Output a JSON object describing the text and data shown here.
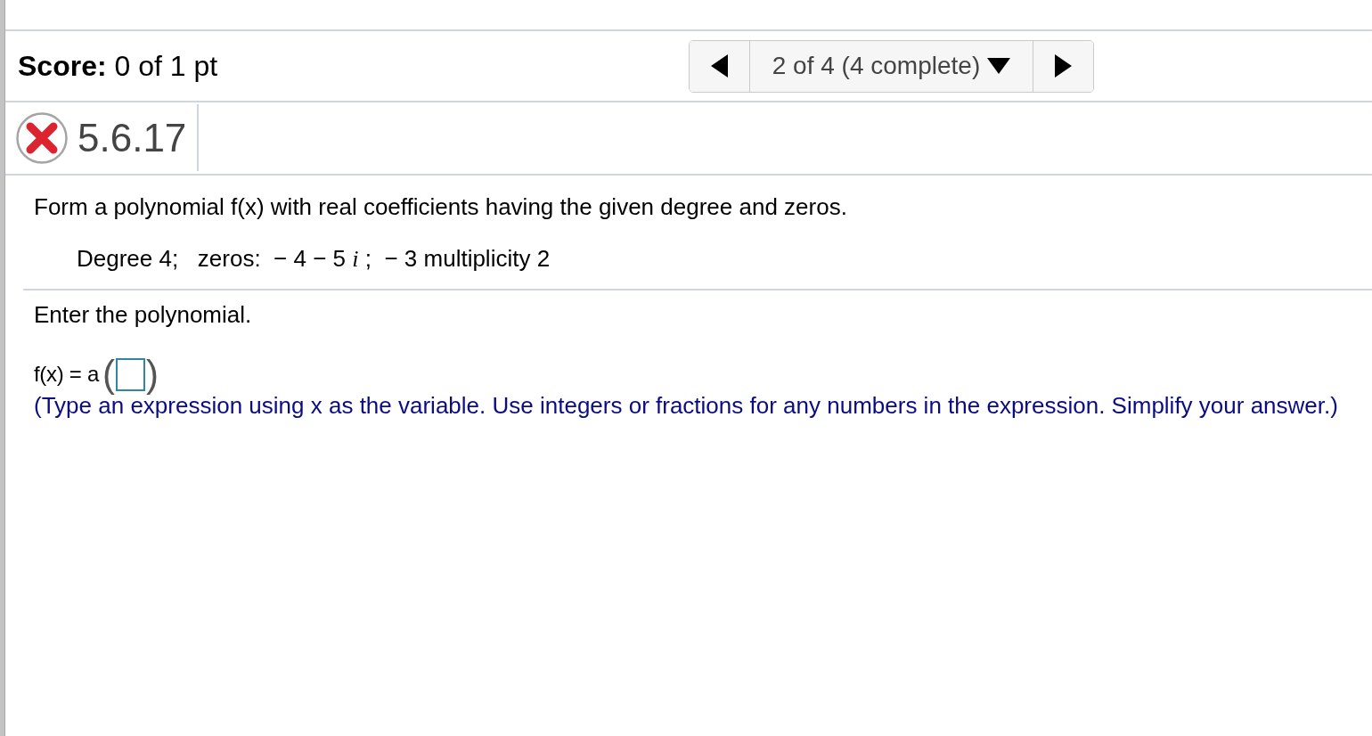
{
  "score": {
    "label": "Score:",
    "value": "0 of 1 pt"
  },
  "question_nav": {
    "current": "2 of 4 (4 complete)"
  },
  "question": {
    "number": "5.6.17",
    "correct": false
  },
  "problem": {
    "statement": "Form a polynomial f(x) with real coefficients having the given degree and zeros.",
    "given": "Degree 4;   zeros:  − 4 − 5 *i* ;  − 3 multiplicity 2"
  },
  "answer": {
    "prompt": "Enter the polynomial.",
    "expression": "f(x) = a",
    "open_bracket": "(",
    "close_bracket": ")",
    "hint": "(Type an expression using x as the variable. Use integers or fractions for any numbers in the expression. Simplify your answer.)"
  }
}
